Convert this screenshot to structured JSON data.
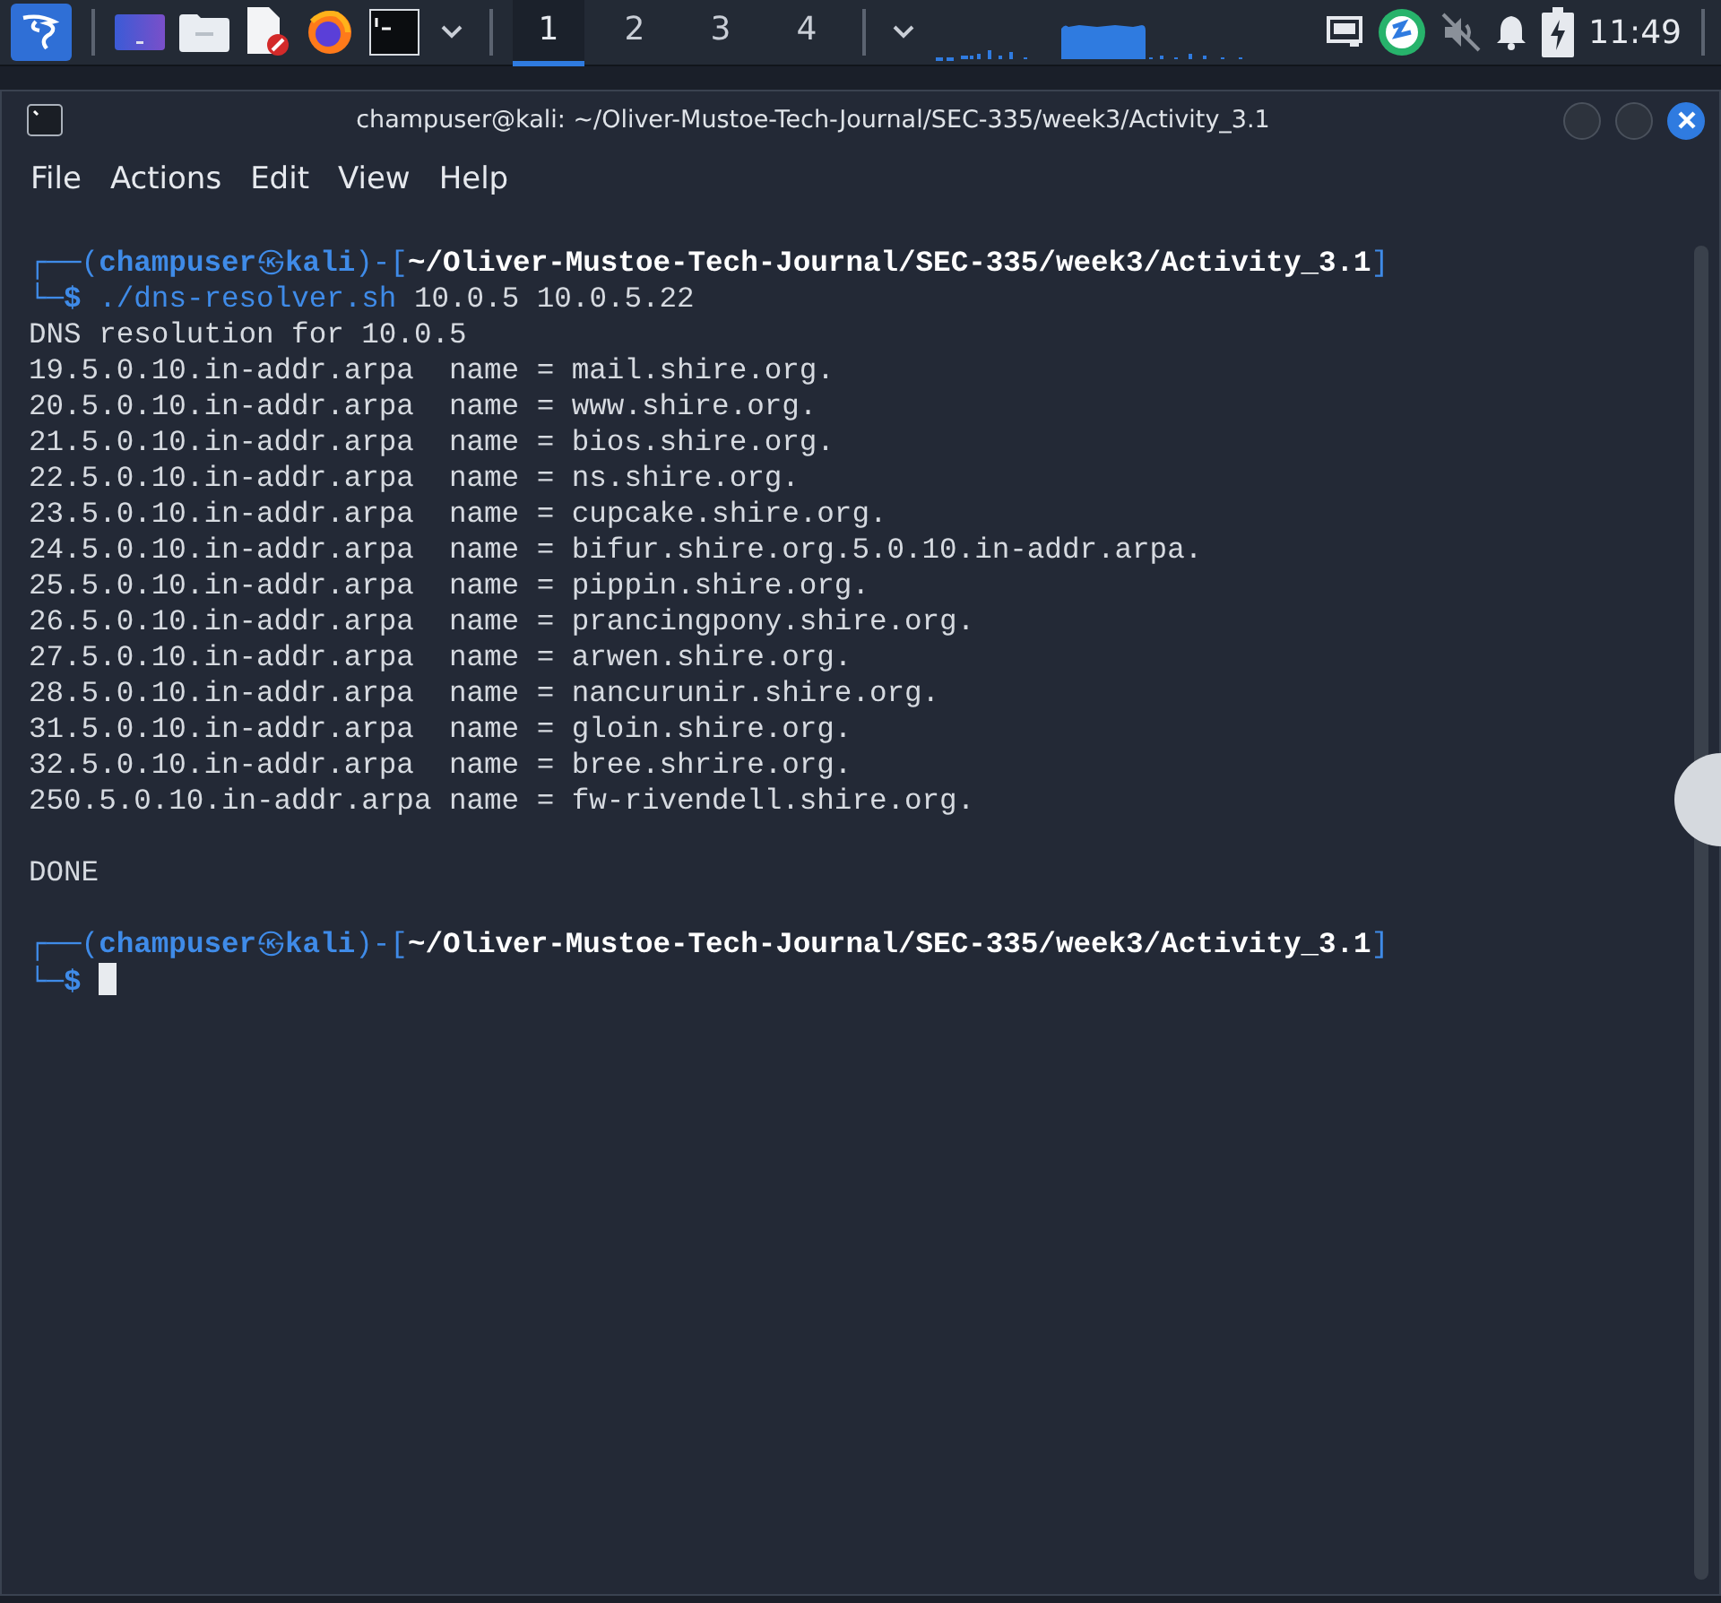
{
  "panel": {
    "workspaces": [
      {
        "label": "1",
        "selected": true
      },
      {
        "label": "2",
        "selected": false
      },
      {
        "label": "3",
        "selected": false
      },
      {
        "label": "4",
        "selected": false
      }
    ],
    "clock": "11:49"
  },
  "window": {
    "title": "champuser@kali: ~/Oliver-Mustoe-Tech-Journal/SEC-335/week3/Activity_3.1",
    "menu": [
      "File",
      "Actions",
      "Edit",
      "View",
      "Help"
    ]
  },
  "terminal": {
    "lines": [
      {
        "kind": "prompt",
        "open": "┌──(",
        "user": "champuser",
        "at": "㉿",
        "host": "kali",
        "mid": ")-[",
        "path": "~/Oliver-Mustoe-Tech-Journal/SEC-335/week3/Activity_3.1",
        "close": "]"
      },
      {
        "kind": "command",
        "corner": "└─",
        "symbol": "$",
        "command": "./dns-resolver.sh",
        "args": "10.0.5 10.0.5.22"
      },
      {
        "kind": "output",
        "text": "DNS resolution for 10.0.5"
      },
      {
        "kind": "output",
        "text": "19.5.0.10.in-addr.arpa  name = mail.shire.org."
      },
      {
        "kind": "output",
        "text": "20.5.0.10.in-addr.arpa  name = www.shire.org."
      },
      {
        "kind": "output",
        "text": "21.5.0.10.in-addr.arpa  name = bios.shire.org."
      },
      {
        "kind": "output",
        "text": "22.5.0.10.in-addr.arpa  name = ns.shire.org."
      },
      {
        "kind": "output",
        "text": "23.5.0.10.in-addr.arpa  name = cupcake.shire.org."
      },
      {
        "kind": "output",
        "text": "24.5.0.10.in-addr.arpa  name = bifur.shire.org.5.0.10.in-addr.arpa."
      },
      {
        "kind": "output",
        "text": "25.5.0.10.in-addr.arpa  name = pippin.shire.org."
      },
      {
        "kind": "output",
        "text": "26.5.0.10.in-addr.arpa  name = prancingpony.shire.org."
      },
      {
        "kind": "output",
        "text": "27.5.0.10.in-addr.arpa  name = arwen.shire.org."
      },
      {
        "kind": "output",
        "text": "28.5.0.10.in-addr.arpa  name = nancurunir.shire.org."
      },
      {
        "kind": "output",
        "text": "31.5.0.10.in-addr.arpa  name = gloin.shire.org."
      },
      {
        "kind": "output",
        "text": "32.5.0.10.in-addr.arpa  name = bree.shrire.org."
      },
      {
        "kind": "output",
        "text": "250.5.0.10.in-addr.arpa name = fw-rivendell.shire.org."
      },
      {
        "kind": "blank"
      },
      {
        "kind": "output",
        "text": "DONE"
      },
      {
        "kind": "blank"
      },
      {
        "kind": "prompt",
        "open": "┌──(",
        "user": "champuser",
        "at": "㉿",
        "host": "kali",
        "mid": ")-[",
        "path": "~/Oliver-Mustoe-Tech-Journal/SEC-335/week3/Activity_3.1",
        "close": "]"
      },
      {
        "kind": "input",
        "corner": "└─",
        "symbol": "$"
      }
    ]
  }
}
